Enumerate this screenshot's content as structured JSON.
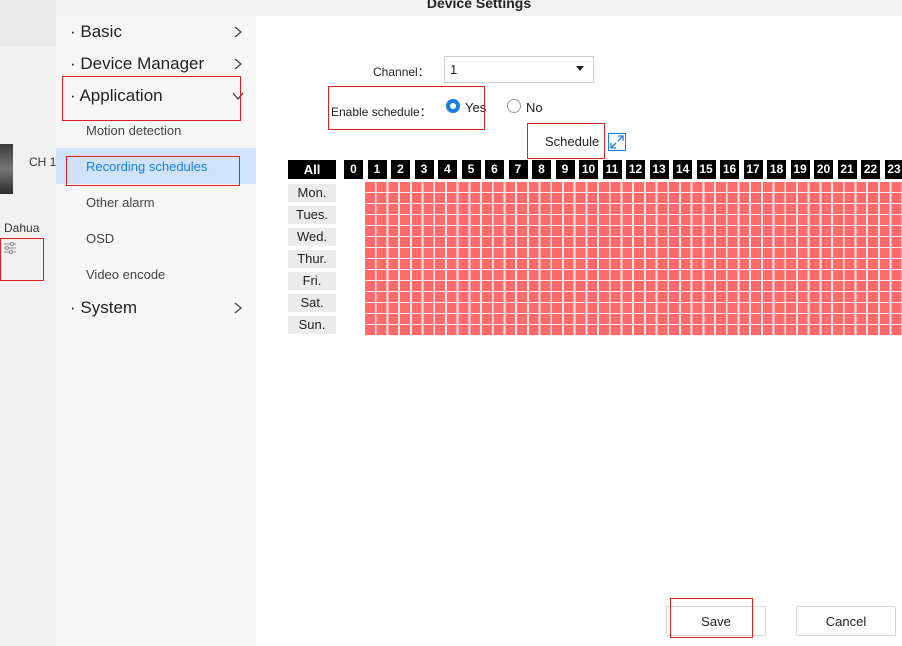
{
  "window": {
    "title": "Device Settings"
  },
  "background_app": {
    "camera_label": "CH 1",
    "device_name": "Dahua"
  },
  "sidenav": {
    "groups": [
      {
        "label": "· Basic"
      },
      {
        "label": "· Device Manager"
      },
      {
        "label": "· Application"
      },
      {
        "label": "· System"
      }
    ],
    "application_items": [
      {
        "label": "Motion detection"
      },
      {
        "label": "Recording schedules"
      },
      {
        "label": "Other alarm"
      },
      {
        "label": "OSD"
      },
      {
        "label": "Video encode"
      }
    ]
  },
  "form": {
    "channel_label": "Channel：",
    "channel_value": "1",
    "enable_label": "Enable schedule：",
    "yes_label": "Yes",
    "no_label": "No",
    "enable_selected": "Yes",
    "schedule_label": "Schedule"
  },
  "schedule": {
    "all_label": "All",
    "hours": [
      "0",
      "1",
      "2",
      "3",
      "4",
      "5",
      "6",
      "7",
      "8",
      "9",
      "10",
      "11",
      "12",
      "13",
      "14",
      "15",
      "16",
      "17",
      "18",
      "19",
      "20",
      "21",
      "22",
      "23"
    ],
    "days": [
      "Mon.",
      "Tues.",
      "Wed.",
      "Thur.",
      "Fri.",
      "Sat.",
      "Sun."
    ],
    "cell_color": "#ff6b6b"
  },
  "footer": {
    "save_label": "Save",
    "cancel_label": "Cancel"
  },
  "colors": {
    "accent": "#1a7fe0",
    "annotation": "#e02020",
    "active_nav_bg": "#cfe4fa"
  }
}
